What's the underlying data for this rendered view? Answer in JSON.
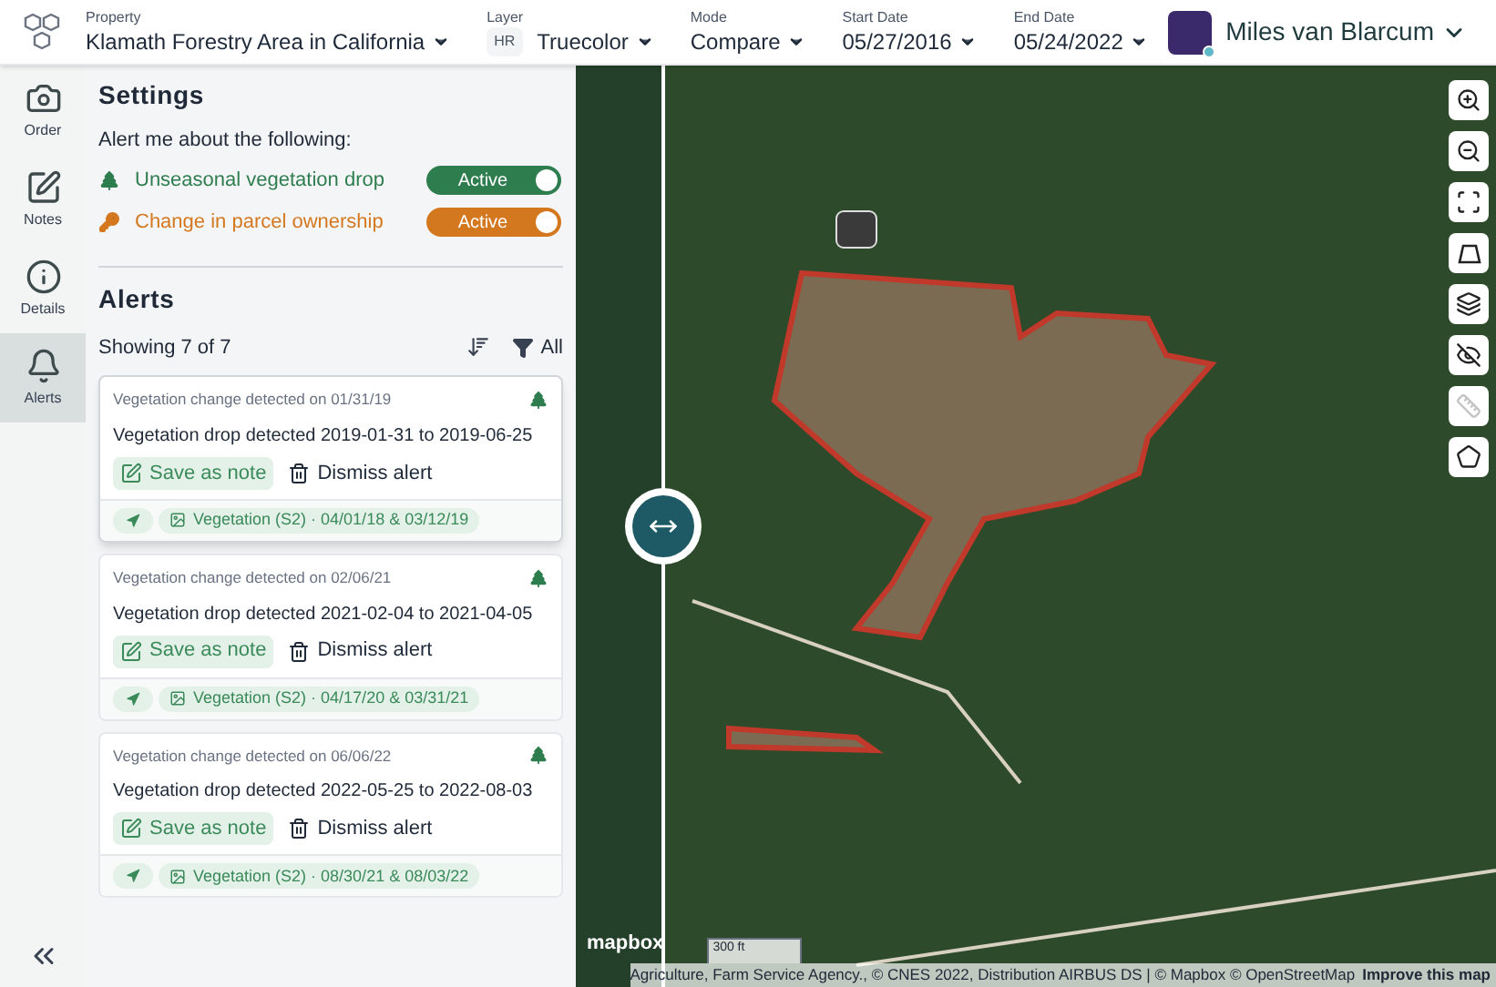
{
  "header": {
    "fields": [
      {
        "label": "Property",
        "value": "Klamath Forestry Area in California"
      },
      {
        "label": "Layer",
        "badge": "HR",
        "value": "Truecolor"
      },
      {
        "label": "Mode",
        "value": "Compare"
      },
      {
        "label": "Start Date",
        "value": "05/27/2016"
      },
      {
        "label": "End Date",
        "value": "05/24/2022"
      }
    ],
    "user": {
      "name": "Miles van Blarcum"
    }
  },
  "rail": {
    "items": [
      {
        "kind": "camera",
        "label": "Order",
        "selected": false
      },
      {
        "kind": "notes",
        "label": "Notes",
        "selected": false
      },
      {
        "kind": "info",
        "label": "Details",
        "selected": false
      },
      {
        "kind": "bell",
        "label": "Alerts",
        "selected": true
      }
    ]
  },
  "settings": {
    "title": "Settings",
    "prompt": "Alert me about the following:",
    "rules": [
      {
        "kind": "tree",
        "label": "Unseasonal vegetation drop",
        "toggle": "Active",
        "on": true,
        "color": "#2e7d4f"
      },
      {
        "kind": "key",
        "label": "Change in parcel ownership",
        "toggle": "Active",
        "on": true,
        "color": "#d4781f"
      }
    ]
  },
  "alerts": {
    "title": "Alerts",
    "count": "Showing 7 of 7",
    "filter": "All",
    "cards": [
      {
        "header": "Vegetation change detected on 01/31/19",
        "title": "Vegetation drop detected 2019-01-31 to 2019-06-25",
        "save": "Save as note",
        "dismiss": "Dismiss alert",
        "chip": "Vegetation (S2) · 04/01/18 & 03/12/19",
        "selected": true
      },
      {
        "header": "Vegetation change detected on 02/06/21",
        "title": "Vegetation drop detected 2021-02-04 to 2021-04-05",
        "save": "Save as note",
        "dismiss": "Dismiss alert",
        "chip": "Vegetation (S2) · 04/17/20 & 03/31/21",
        "selected": false
      },
      {
        "header": "Vegetation change detected on 06/06/22",
        "title": "Vegetation drop detected 2022-05-25 to 2022-08-03",
        "save": "Save as note",
        "dismiss": "Dismiss alert",
        "chip": "Vegetation (S2) · 08/30/21 & 08/03/22",
        "selected": false
      }
    ]
  },
  "map": {
    "tools": [
      {
        "kind": "zoom-in",
        "disabled": false
      },
      {
        "kind": "zoom-out",
        "disabled": false
      },
      {
        "kind": "fit",
        "disabled": false
      },
      {
        "kind": "perspective",
        "disabled": false
      },
      {
        "kind": "layers",
        "disabled": false
      },
      {
        "kind": "hide",
        "disabled": false
      },
      {
        "kind": "ruler",
        "disabled": true
      },
      {
        "kind": "polygon",
        "disabled": false
      }
    ],
    "logo": "mapbox",
    "scale": "300 ft",
    "attribution": "Agriculture, Farm Service Agency., © CNES 2022, Distribution AIRBUS DS | © Mapbox © OpenStreetMap",
    "improve": "Improve this map"
  }
}
